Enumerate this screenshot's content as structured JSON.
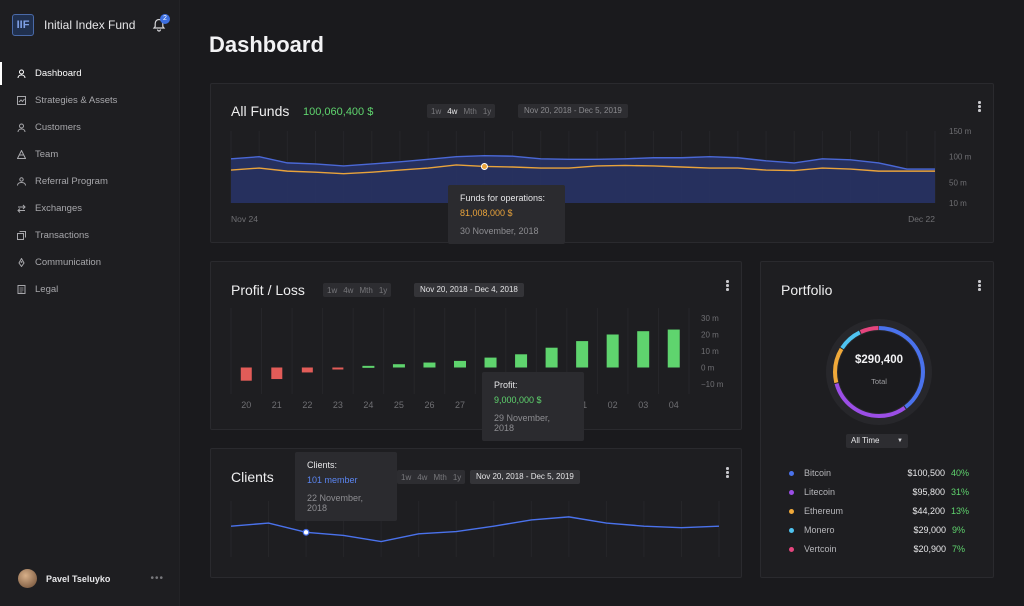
{
  "app": {
    "name": "Initial Index Fund",
    "logo_text": "IIF",
    "notifications": "2"
  },
  "nav": [
    {
      "label": "Dashboard",
      "icon": "user-icon",
      "active": true
    },
    {
      "label": "Strategies & Assets",
      "icon": "chart-icon"
    },
    {
      "label": "Customers",
      "icon": "user-icon"
    },
    {
      "label": "Team",
      "icon": "pyramid-icon"
    },
    {
      "label": "Referral Program",
      "icon": "users-icon"
    },
    {
      "label": "Exchanges",
      "icon": "exchange-icon"
    },
    {
      "label": "Transactions",
      "icon": "cards-icon"
    },
    {
      "label": "Communication",
      "icon": "rocket-icon"
    },
    {
      "label": "Legal",
      "icon": "document-icon"
    }
  ],
  "user": {
    "name": "Pavel Tseluyko",
    "more": "•••"
  },
  "page": {
    "title": "Dashboard"
  },
  "funds": {
    "title": "All Funds",
    "total": "100,060,400 $",
    "periods": [
      "1w",
      "4w",
      "Mth",
      "1y"
    ],
    "active_period": "4w",
    "range": "Nov 20, 2018 - Dec 5, 2019",
    "x_start": "Nov 24",
    "x_end": "Dec 22",
    "y_ticks": [
      "150 m",
      "100 m",
      "50 m",
      "10 m"
    ],
    "tooltip": {
      "label": "Funds for operations:",
      "value": "81,008,000 $",
      "date": "30 November, 2018"
    }
  },
  "profit": {
    "title": "Profit / Loss",
    "periods": [
      "1w",
      "4w",
      "Mth",
      "1y"
    ],
    "range": "Nov 20, 2018 - Dec 4, 2018",
    "y_ticks": [
      "30 m",
      "20 m",
      "10 m",
      "0 m",
      "−10 m"
    ],
    "tooltip": {
      "label": "Profit:",
      "value": "9,000,000 $",
      "date": "29 November, 2018"
    }
  },
  "clients": {
    "title": "Clients",
    "periods": [
      "1w",
      "4w",
      "Mth",
      "1y"
    ],
    "range": "Nov 20, 2018 - Dec 5, 2019",
    "tooltip": {
      "label": "Clients:",
      "value": "101 member",
      "date": "22 November, 2018"
    }
  },
  "portfolio": {
    "title": "Portfolio",
    "total": "$290,400",
    "total_label": "Total",
    "filter": "All Time",
    "coins": [
      {
        "name": "Bitcoin",
        "value": "$100,500",
        "pct": "40%",
        "color": "#4a72ec"
      },
      {
        "name": "Litecoin",
        "value": "$95,800",
        "pct": "31%",
        "color": "#9b4ee6"
      },
      {
        "name": "Ethereum",
        "value": "$44,200",
        "pct": "13%",
        "color": "#f0a93a"
      },
      {
        "name": "Monero",
        "value": "$29,000",
        "pct": "9%",
        "color": "#4fc3f0"
      },
      {
        "name": "Vertcoin",
        "value": "$20,900",
        "pct": "7%",
        "color": "#e5457e"
      }
    ]
  },
  "chart_data": [
    {
      "type": "area",
      "title": "All Funds",
      "x": [
        "Nov 24",
        "",
        "",
        "",
        "",
        "",
        "",
        "",
        "",
        "",
        "",
        "",
        "",
        "",
        "",
        "",
        "",
        "",
        "",
        "",
        "",
        "",
        "",
        "",
        "",
        "Dec 22"
      ],
      "ylim": [
        10,
        150
      ],
      "series": [
        {
          "name": "Funds",
          "color": "#4a68d6",
          "values": [
            96,
            100,
            88,
            86,
            82,
            86,
            90,
            95,
            100,
            102,
            101,
            96,
            95,
            95,
            96,
            98,
            98,
            100,
            98,
            92,
            88,
            96,
            94,
            88,
            76,
            76
          ]
        },
        {
          "name": "Funds for operations",
          "color": "#e9a33b",
          "values": [
            74,
            78,
            72,
            70,
            67,
            70,
            74,
            78,
            84,
            81,
            80,
            78,
            78,
            82,
            83,
            82,
            80,
            78,
            78,
            74,
            73,
            78,
            76,
            72,
            72,
            72
          ]
        }
      ]
    },
    {
      "type": "bar",
      "title": "Profit / Loss",
      "categories": [
        "20",
        "21",
        "22",
        "23",
        "24",
        "25",
        "26",
        "27",
        "28",
        "29",
        "30",
        "01",
        "02",
        "03",
        "04"
      ],
      "values": [
        -8,
        -7,
        -3,
        -1,
        1,
        2,
        3,
        4,
        6,
        8,
        12,
        16,
        20,
        22,
        23
      ],
      "ylim": [
        -10,
        30
      ],
      "colors": {
        "positive": "#5fd46e",
        "negative": "#e25c58"
      }
    },
    {
      "type": "line",
      "title": "Clients",
      "values": [
        100,
        104,
        92,
        88,
        80,
        90,
        93,
        100,
        108,
        112,
        104,
        100,
        98,
        100
      ],
      "color": "#4a72ec"
    }
  ]
}
